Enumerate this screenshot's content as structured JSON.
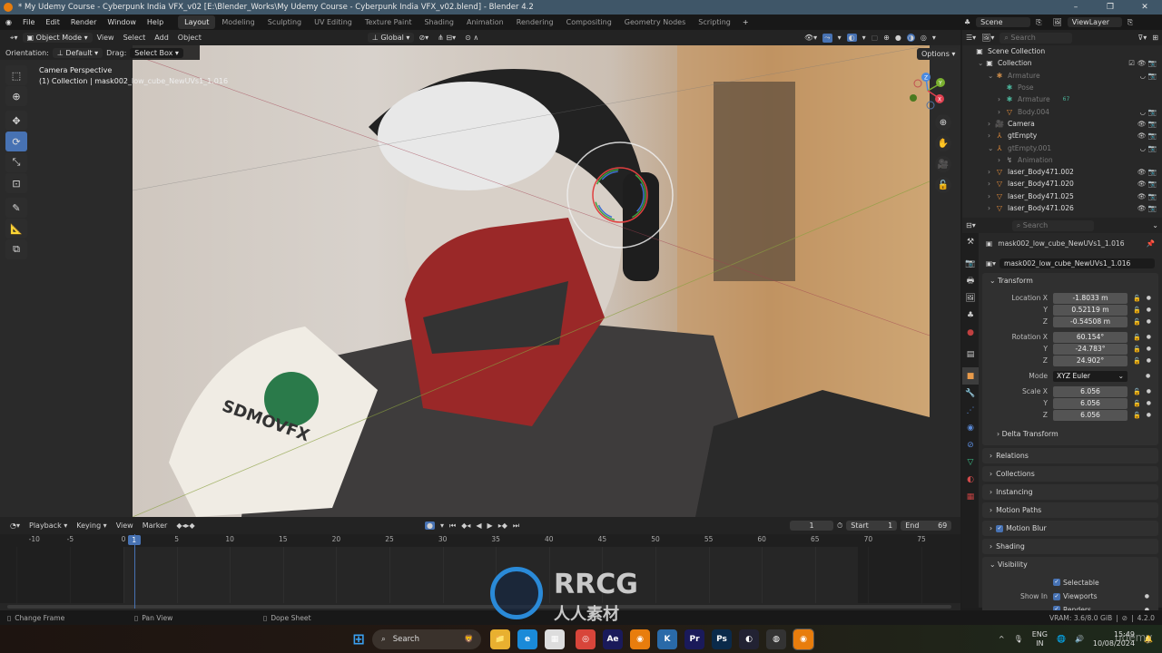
{
  "window": {
    "title": "* My Udemy Course - Cyberpunk India VFX_v02 [E:\\Blender_Works\\My Udemy Course - Cyberpunk India VFX_v02.blend] - Blender 4.2",
    "minimize": "–",
    "maximize": "❐",
    "close": "✕"
  },
  "menu": {
    "items": [
      "File",
      "Edit",
      "Render",
      "Window",
      "Help"
    ],
    "workspaces": [
      "Layout",
      "Modeling",
      "Sculpting",
      "UV Editing",
      "Texture Paint",
      "Shading",
      "Animation",
      "Rendering",
      "Compositing",
      "Geometry Nodes",
      "Scripting"
    ],
    "active_workspace": "Layout",
    "add_workspace": "+",
    "scene_label": "Scene",
    "viewlayer_label": "ViewLayer"
  },
  "viewport_header": {
    "mode": "Object Mode",
    "menus": [
      "View",
      "Select",
      "Add",
      "Object"
    ],
    "transform_orientation": "Global"
  },
  "tool_header": {
    "orientation_label": "Orientation:",
    "orientation_value": "Default",
    "drag_label": "Drag:",
    "drag_value": "Select Box"
  },
  "viewport": {
    "view_name": "Camera Perspective",
    "object_info": "(1) Collection | mask002_low_cube_NewUVs1_1.016",
    "options_label": "Options",
    "cup_text": "SDMOVFX"
  },
  "tools": [
    {
      "name": "select-box-icon",
      "glyph": "⬚",
      "active": false
    },
    {
      "name": "cursor-icon",
      "glyph": "⊕",
      "active": false
    },
    {
      "name": "move-icon",
      "glyph": "✥",
      "active": false
    },
    {
      "name": "rotate-icon",
      "glyph": "⟳",
      "active": true
    },
    {
      "name": "scale-icon",
      "glyph": "⤡",
      "active": false
    },
    {
      "name": "transform-icon",
      "glyph": "⊡",
      "active": false
    },
    {
      "name": "annotate-icon",
      "glyph": "✎",
      "active": false
    },
    {
      "name": "measure-icon",
      "glyph": "📐",
      "active": false
    },
    {
      "name": "add-cube-icon",
      "glyph": "⧉",
      "active": false
    }
  ],
  "outliner": {
    "search_placeholder": "Search",
    "rows": [
      {
        "label": "Scene Collection",
        "icon": "▣",
        "indent": 0,
        "dim": false,
        "color": "#ddd",
        "vis": ""
      },
      {
        "label": "Collection",
        "icon": "▣",
        "indent": 1,
        "dim": false,
        "color": "#ddd",
        "vis": "☑ 👁 📷",
        "expand": "⌄"
      },
      {
        "label": "Armature",
        "icon": "✱",
        "indent": 2,
        "dim": true,
        "color": "#c88a4a",
        "vis": "◡ 📷",
        "expand": "⌄"
      },
      {
        "label": "Pose",
        "icon": "✱",
        "indent": 3,
        "dim": true,
        "color": "#4bb39a",
        "vis": ""
      },
      {
        "label": "Armature",
        "icon": "✱",
        "indent": 3,
        "dim": true,
        "color": "#4bb39a",
        "vis": "",
        "expand": "›",
        "extra": "67"
      },
      {
        "label": "Body.004",
        "icon": "▽",
        "indent": 3,
        "dim": true,
        "color": "#e08a3a",
        "vis": "◡ 📷",
        "expand": "›"
      },
      {
        "label": "Camera",
        "icon": "🎥",
        "indent": 2,
        "dim": false,
        "color": "#e08a3a",
        "vis": "👁 📷",
        "expand": "›"
      },
      {
        "label": "gtEmpty",
        "icon": "⅄",
        "indent": 2,
        "dim": false,
        "color": "#e08a3a",
        "vis": "👁 📷",
        "expand": "›"
      },
      {
        "label": "gtEmpty.001",
        "icon": "⅄",
        "indent": 2,
        "dim": true,
        "color": "#e08a3a",
        "vis": "◡ 📷",
        "expand": "⌄"
      },
      {
        "label": "Animation",
        "icon": "↯",
        "indent": 3,
        "dim": true,
        "color": "#999",
        "vis": "",
        "expand": "›"
      },
      {
        "label": "laser_Body471.002",
        "icon": "▽",
        "indent": 2,
        "dim": false,
        "color": "#e08a3a",
        "vis": "👁 📷",
        "expand": "›"
      },
      {
        "label": "laser_Body471.020",
        "icon": "▽",
        "indent": 2,
        "dim": false,
        "color": "#e08a3a",
        "vis": "👁 📷",
        "expand": "›"
      },
      {
        "label": "laser_Body471.025",
        "icon": "▽",
        "indent": 2,
        "dim": false,
        "color": "#e08a3a",
        "vis": "👁 📷",
        "expand": "›"
      },
      {
        "label": "laser_Body471.026",
        "icon": "▽",
        "indent": 2,
        "dim": false,
        "color": "#e08a3a",
        "vis": "👁 📷",
        "expand": "›"
      }
    ]
  },
  "properties": {
    "search_placeholder": "Search",
    "object_name": "mask002_low_cube_NewUVs1_1.016",
    "datablock_name": "mask002_low_cube_NewUVs1_1.016",
    "tabs": [
      {
        "name": "tool-tab-icon",
        "glyph": "⚒",
        "color": "#ccc"
      },
      {
        "name": "render-tab-icon",
        "glyph": "📷",
        "color": "#ccc"
      },
      {
        "name": "output-tab-icon",
        "glyph": "🖶",
        "color": "#ccc"
      },
      {
        "name": "view-layer-tab-icon",
        "glyph": "🖼",
        "color": "#ccc"
      },
      {
        "name": "scene-tab-icon",
        "glyph": "♣",
        "color": "#ccc"
      },
      {
        "name": "world-tab-icon",
        "glyph": "●",
        "color": "#c04040"
      },
      {
        "name": "collection-tab-icon",
        "glyph": "▤",
        "color": "#ccc"
      },
      {
        "name": "object-tab-icon",
        "glyph": "■",
        "color": "#e89a4a",
        "active": true
      },
      {
        "name": "modifier-tab-icon",
        "glyph": "🔧",
        "color": "#5a8ad8"
      },
      {
        "name": "particles-tab-icon",
        "glyph": "⋰",
        "color": "#5a8ad8"
      },
      {
        "name": "physics-tab-icon",
        "glyph": "◉",
        "color": "#5a8ad8"
      },
      {
        "name": "constraints-tab-icon",
        "glyph": "⊘",
        "color": "#5a8ad8"
      },
      {
        "name": "data-tab-icon",
        "glyph": "▽",
        "color": "#3cc08a"
      },
      {
        "name": "material-tab-icon",
        "glyph": "◐",
        "color": "#d04a4a"
      },
      {
        "name": "texture-tab-icon",
        "glyph": "▦",
        "color": "#c04040"
      }
    ],
    "transform": {
      "title": "Transform",
      "location_label": "Location X",
      "location": [
        "-1.8033 m",
        "0.52119 m",
        "-0.54508 m"
      ],
      "rotation_label": "Rotation X",
      "rotation": [
        "60.154°",
        "-24.783°",
        "24.902°"
      ],
      "mode_label": "Mode",
      "mode": "XYZ Euler",
      "scale_label": "Scale X",
      "scale": [
        "6.056",
        "6.056",
        "6.056"
      ],
      "y_label": "Y",
      "z_label": "Z",
      "delta": "Delta Transform"
    },
    "panels": [
      "Relations",
      "Collections",
      "Instancing",
      "Motion Paths",
      "Motion Blur",
      "Shading"
    ],
    "visibility": {
      "title": "Visibility",
      "selectable": "Selectable",
      "show_in": "Show In",
      "viewports": "Viewports",
      "renders": "Renders"
    }
  },
  "timeline": {
    "menus": [
      "Playback",
      "Keying",
      "View",
      "Marker"
    ],
    "current_frame": "1",
    "start_label": "Start",
    "start": "1",
    "end_label": "End",
    "end": "69",
    "ticks": [
      -10,
      -5,
      0,
      5,
      10,
      15,
      20,
      25,
      30,
      35,
      40,
      45,
      50,
      55,
      60,
      65,
      70,
      75
    ],
    "playhead_frame": "1"
  },
  "statusbar": {
    "items": [
      "Change Frame",
      "Pan View",
      "Dope Sheet"
    ],
    "vram": "VRAM: 3.6/8.0 GiB",
    "version": "4.2.0"
  },
  "taskbar": {
    "search": "Search",
    "language": "ENG",
    "region": "IN",
    "time": "15:49",
    "date": "10/08/2024",
    "apps": [
      {
        "name": "file-explorer-icon",
        "label": "📁",
        "bg": "#e8b030"
      },
      {
        "name": "edge-icon",
        "label": "e",
        "bg": "#1a8ad8"
      },
      {
        "name": "store-icon",
        "label": "▦",
        "bg": "#ddd"
      },
      {
        "name": "chrome-icon",
        "label": "◎",
        "bg": "#d8453a"
      },
      {
        "name": "after-effects-icon",
        "label": "Ae",
        "bg": "#1a1a5a"
      },
      {
        "name": "blender-icon",
        "label": "◉",
        "bg": "#e87d0d"
      },
      {
        "name": "k-app-icon",
        "label": "K",
        "bg": "#2a6aa8"
      },
      {
        "name": "premiere-icon",
        "label": "Pr",
        "bg": "#1a1a5a"
      },
      {
        "name": "photoshop-icon",
        "label": "Ps",
        "bg": "#0a2a4a"
      },
      {
        "name": "cinema4d-icon",
        "label": "◐",
        "bg": "#223"
      },
      {
        "name": "obs-icon",
        "label": "◍",
        "bg": "#333"
      },
      {
        "name": "blender-active-icon",
        "label": "◉",
        "bg": "#e87d0d"
      }
    ]
  },
  "watermark": {
    "brand": "RRCG",
    "sub": "人人素材",
    "udemy": "udemy"
  }
}
